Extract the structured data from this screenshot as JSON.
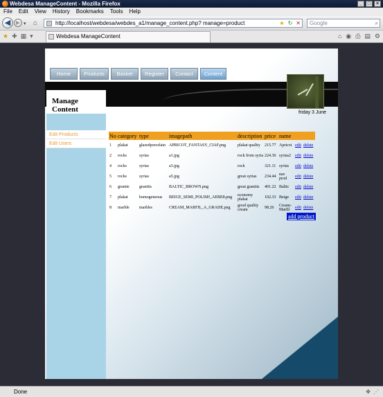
{
  "window": {
    "title": "Webdesa ManageContent - Mozilla Firefox"
  },
  "menu": [
    "File",
    "Edit",
    "View",
    "History",
    "Bookmarks",
    "Tools",
    "Help"
  ],
  "navbar": {
    "url": "http://localhost/webdesa/webdes_a1/manage_content.php? manage=product",
    "search_placeholder": "Google"
  },
  "tab": {
    "title": "Webdesa ManageContent"
  },
  "site": {
    "nav": [
      "Home",
      "Products",
      "Basket",
      "Register",
      "Contact",
      "Content"
    ],
    "active_nav": "Content",
    "manage_title": "Manage Content",
    "date": "friday 3 June",
    "sidebar": [
      "Edit Products",
      "Edit Users"
    ]
  },
  "table": {
    "headers": [
      "No",
      "category",
      "type",
      "imagepath",
      "description",
      "price",
      "name"
    ],
    "rows": [
      [
        "1",
        "plakat",
        "glazedporcelain",
        "APRICOT_FANTASY_CIAF.png",
        "plakat quality",
        "215.77",
        "Apricot",
        "edit",
        "delete"
      ],
      [
        "2",
        "rocks",
        "syrias",
        "a1.jpg",
        "rock from syria",
        "224.36",
        "syrias2",
        "edit",
        "delete"
      ],
      [
        "4",
        "rocks",
        "syrias",
        "a3.jpg",
        "rock",
        "321.11",
        "syrias",
        "edit",
        "delete"
      ],
      [
        "5",
        "rocks",
        "syrias",
        "a5.jpg",
        "great syrias",
        "234.44",
        "nav prod",
        "edit",
        "delete"
      ],
      [
        "6",
        "granite",
        "granitis",
        "BALTIC_BROWN.png",
        "great granitis",
        "401.22",
        "Baltic",
        "edit",
        "delete"
      ],
      [
        "7",
        "plakat",
        "homogeneous",
        "BEIGE_SEMI_POLISH_AEBE8.png",
        "economy plakat",
        "102.33",
        "Beige",
        "edit",
        "delete"
      ],
      [
        "8",
        "marble",
        "marbles",
        "CREAM_MARFIL_A_GRADE.png",
        "good quality cream",
        "98.26",
        "Cream-Marfil",
        "edit",
        "delete"
      ]
    ],
    "add_label": "add product"
  },
  "status": {
    "text": "Done"
  }
}
